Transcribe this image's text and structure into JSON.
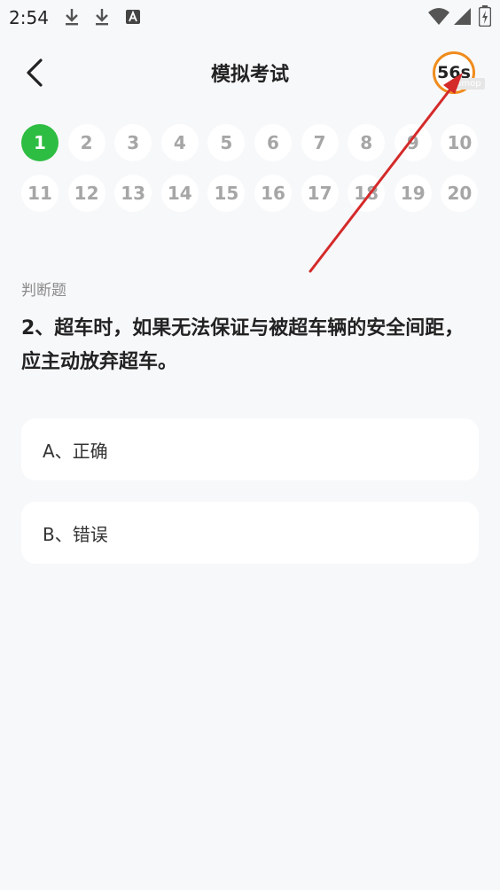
{
  "status_bar": {
    "time": "2:54",
    "icons": [
      "download-icon",
      "download-icon",
      "text-app-icon",
      "wifi-icon",
      "signal-icon",
      "battery-icon"
    ]
  },
  "header": {
    "back_icon": "chevron-left-icon",
    "title": "模拟考试",
    "timer": "56s",
    "watermark": "8mop"
  },
  "question_grid": {
    "active": 1,
    "numbers": [
      "1",
      "2",
      "3",
      "4",
      "5",
      "6",
      "7",
      "8",
      "9",
      "10",
      "11",
      "12",
      "13",
      "14",
      "15",
      "16",
      "17",
      "18",
      "19",
      "20"
    ]
  },
  "question": {
    "type": "判断题",
    "text": "2、超车时，如果无法保证与被超车辆的安全间距，应主动放弃超车。"
  },
  "options": [
    {
      "label": "A、正确"
    },
    {
      "label": "B、错误"
    }
  ],
  "annotation": {
    "arrow_color": "#d42a2a"
  }
}
